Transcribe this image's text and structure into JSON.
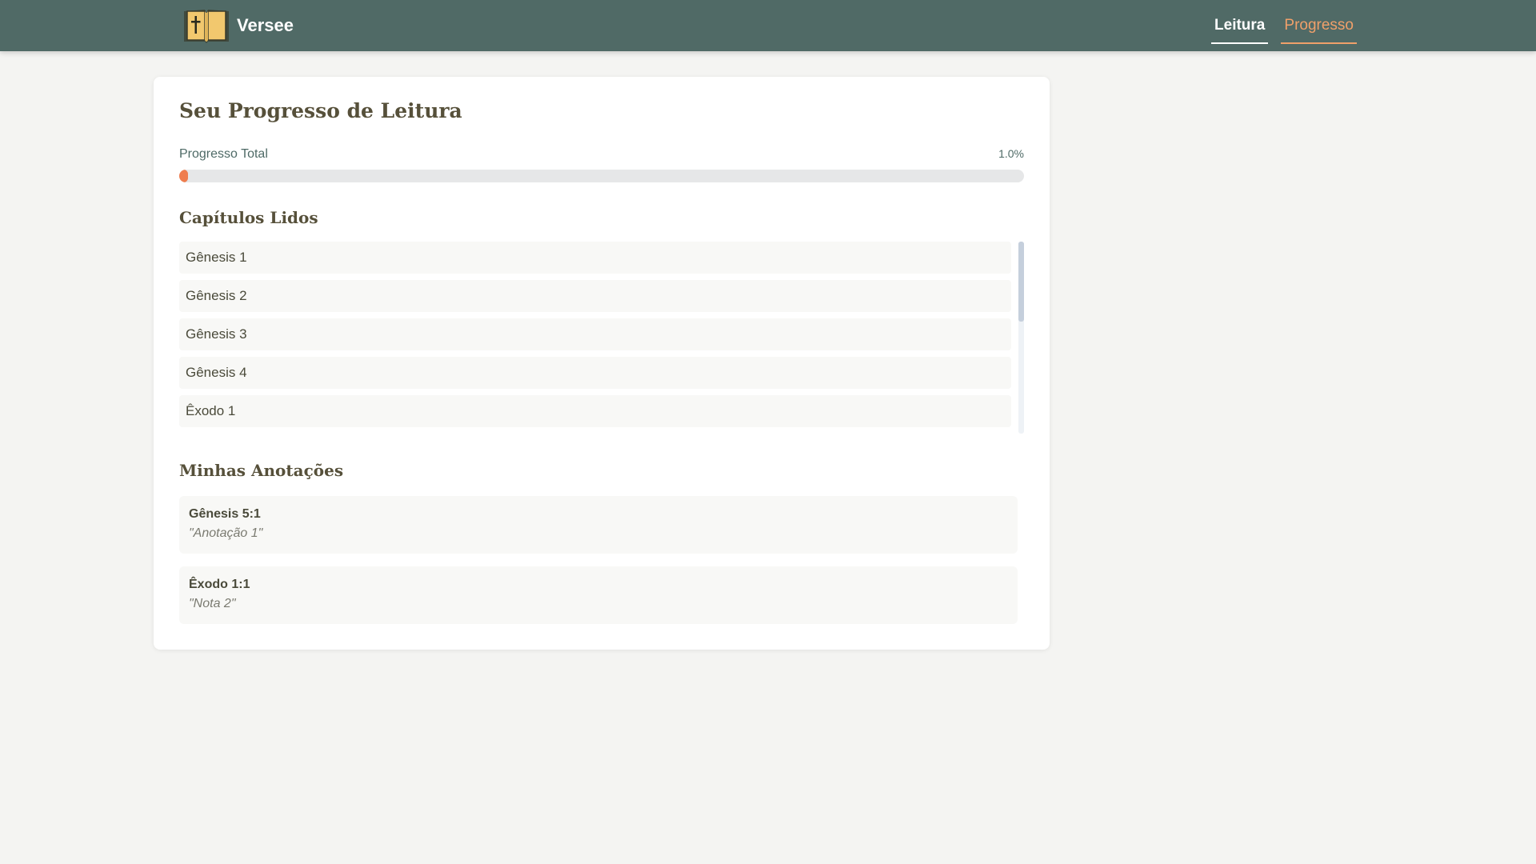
{
  "header": {
    "brand": "Versee",
    "logo_icon": "bible-book-icon",
    "nav": [
      {
        "label": "Leitura",
        "state": "active-white"
      },
      {
        "label": "Progresso",
        "state": "current-accent"
      }
    ]
  },
  "progress": {
    "title": "Seu Progresso de Leitura",
    "total_label": "Progresso Total",
    "total_value": "1.0%",
    "percent": 1.0
  },
  "chapters": {
    "title": "Capítulos Lidos",
    "items": [
      "Gênesis 1",
      "Gênesis 2",
      "Gênesis 3",
      "Gênesis 4",
      "Êxodo 1"
    ]
  },
  "notes": {
    "title": "Minhas Anotações",
    "items": [
      {
        "ref": "Gênesis 5:1",
        "text": "\"Anotação 1\""
      },
      {
        "ref": "Êxodo 1:1",
        "text": "\"Nota 2\""
      }
    ]
  },
  "colors": {
    "header_bg": "#506a66",
    "accent": "#ef7d4e",
    "page_bg": "#f4f4f2"
  }
}
